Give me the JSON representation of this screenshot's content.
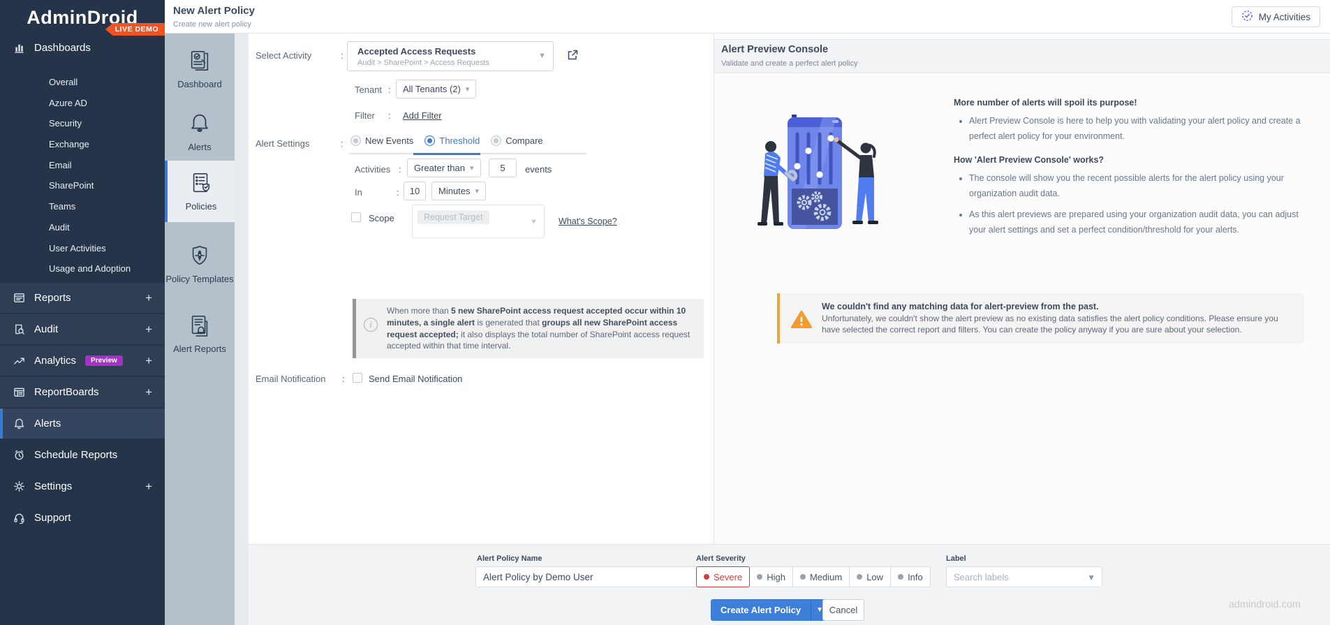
{
  "brand": {
    "name": "AdminDroid",
    "badge": "LIVE DEMO"
  },
  "sidebar": {
    "dashboards": {
      "label": "Dashboards",
      "icon": "bar-chart-icon",
      "items": [
        "Overall",
        "Azure AD",
        "Security",
        "Exchange",
        "Email",
        "SharePoint",
        "Teams",
        "Audit",
        "User Activities",
        "Usage and Adoption"
      ]
    },
    "groups": [
      {
        "label": "Reports",
        "icon": "report-icon",
        "expandable": true
      },
      {
        "label": "Audit",
        "icon": "audit-icon",
        "expandable": true
      },
      {
        "label": "Analytics",
        "icon": "analytics-icon",
        "expandable": true,
        "badge": "Preview"
      },
      {
        "label": "ReportBoards",
        "icon": "reportboards-icon",
        "expandable": true
      },
      {
        "label": "Alerts",
        "icon": "bell-icon",
        "selected": true
      },
      {
        "label": "Schedule Reports",
        "icon": "clock-icon",
        "plain": true
      },
      {
        "label": "Settings",
        "icon": "gear-icon",
        "expandable": true,
        "plain": true
      },
      {
        "label": "Support",
        "icon": "headset-icon",
        "plain": true
      }
    ]
  },
  "iconStrip": [
    {
      "label": "Dashboard",
      "icon": "dashboard-strip-icon"
    },
    {
      "label": "Alerts",
      "icon": "alerts-strip-icon"
    },
    {
      "label": "Policies",
      "icon": "policies-strip-icon",
      "selected": true
    },
    {
      "label": "Policy Templates",
      "icon": "policy-templates-strip-icon"
    },
    {
      "label": "Alert Reports",
      "icon": "alert-reports-strip-icon"
    }
  ],
  "header": {
    "title": "New Alert Policy",
    "subtitle": "Create new alert policy",
    "myActivities": "My Activities"
  },
  "form": {
    "selectActivity": {
      "label": "Select Activity",
      "value": "Accepted Access Requests",
      "path": "Audit > SharePoint > Access Requests"
    },
    "tenant": {
      "label": "Tenant",
      "value": "All Tenants (2)"
    },
    "filter": {
      "label": "Filter",
      "link": "Add Filter"
    },
    "alertSettings": {
      "label": "Alert Settings",
      "options": [
        "New Events",
        "Threshold",
        "Compare"
      ],
      "selected": "Threshold"
    },
    "activities": {
      "label": "Activities",
      "operator": "Greater than",
      "value": "5",
      "unit": "events"
    },
    "interval": {
      "label": "In",
      "value": "10",
      "unit": "Minutes"
    },
    "scope": {
      "label": "Scope",
      "placeholder": "Request Target",
      "link": "What's Scope?",
      "checked": false
    },
    "infoNote": {
      "segments": [
        {
          "text": "When more than ",
          "bold": false
        },
        {
          "text": "5 new SharePoint access request accepted occur within 10 minutes, a single alert",
          "bold": true
        },
        {
          "text": " is generated that ",
          "bold": false
        },
        {
          "text": "groups all new SharePoint access request accepted;",
          "bold": true
        },
        {
          "text": " it also displays the total number of SharePoint access request accepted within that time interval.",
          "bold": false
        }
      ]
    },
    "emailNotification": {
      "label": "Email Notification",
      "checkbox": "Send Email Notification",
      "checked": false
    }
  },
  "preview": {
    "title": "Alert Preview Console",
    "subtitle": "Validate and create a perfect alert policy",
    "sections": [
      {
        "heading": "More number of alerts will spoil its purpose!",
        "bullets": [
          "Alert Preview Console is here to help you with validating your alert policy and create a perfect alert policy for your environment."
        ]
      },
      {
        "heading": "How 'Alert Preview Console' works?",
        "bullets": [
          "The console will show you the recent possible alerts for the alert policy using your organization audit data.",
          "As this alert previews are prepared using your organization audit data, you can adjust your alert settings and set a perfect condition/threshold for your alerts."
        ]
      }
    ],
    "warning": {
      "title": "We couldn't find any matching data for alert-preview from the past.",
      "body": "Unfortunately, we couldn't show the alert preview as no existing data satisfies the alert policy conditions. Please ensure you have selected the correct report and filters. You can create the policy anyway if you are sure about your selection."
    }
  },
  "footer": {
    "policyName": {
      "label": "Alert Policy Name",
      "value": "Alert Policy by Demo User"
    },
    "severity": {
      "label": "Alert Severity",
      "options": [
        "Severe",
        "High",
        "Medium",
        "Low",
        "Info"
      ],
      "selected": "Severe"
    },
    "labelField": {
      "label": "Label",
      "placeholder": "Search labels"
    },
    "createButton": "Create Alert Policy",
    "cancelButton": "Cancel",
    "watermark": "admindroid.com"
  },
  "colors": {
    "accent": "#3a7bd5",
    "sidebar": "#263449",
    "ribbon": "#f05423",
    "severe": "#cf3f3f",
    "warning": "#f0a23c",
    "previewBadge": "#a433c4"
  }
}
